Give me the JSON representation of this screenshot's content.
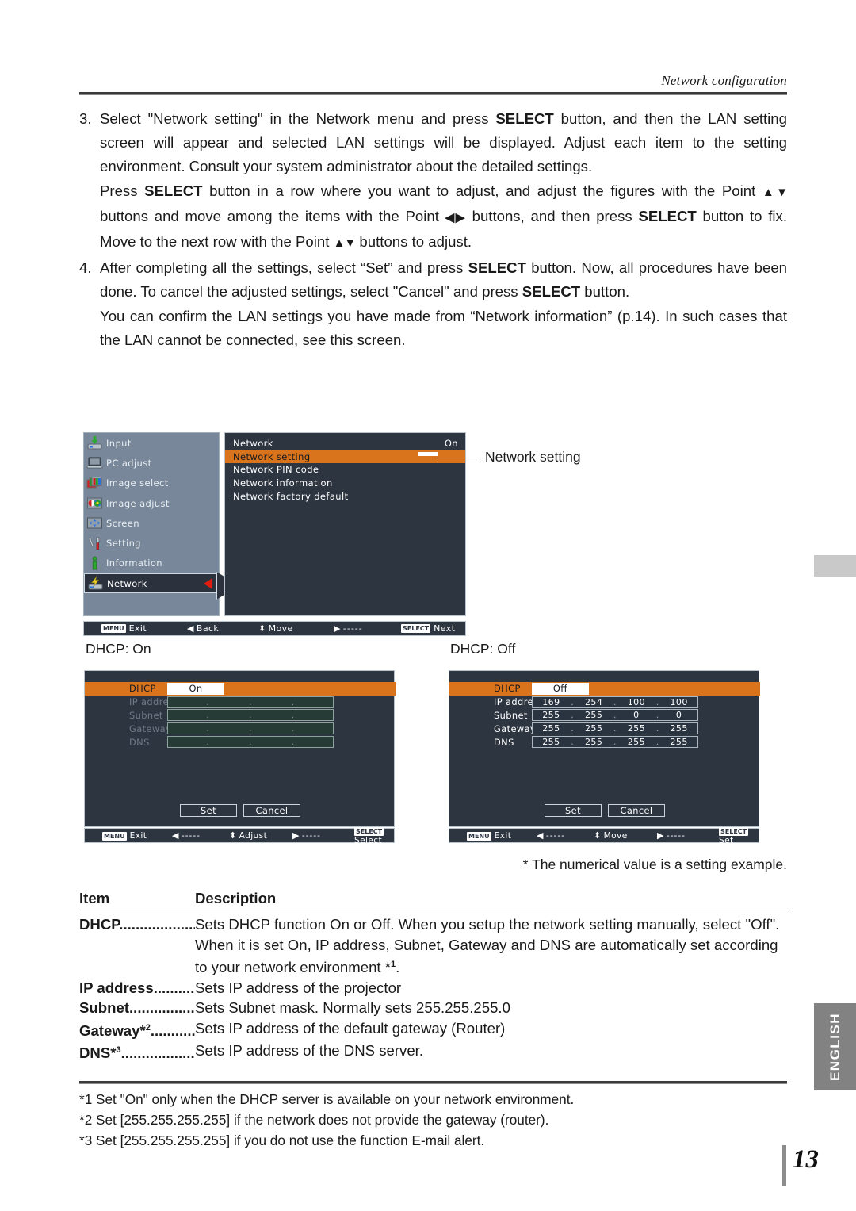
{
  "header": {
    "title": "Network configuration"
  },
  "steps": {
    "s3_num": "3.",
    "s3_a": "Select \"Network setting\" in the Network menu and press ",
    "s3_select": "SELECT",
    "s3_b": " button, and then the LAN setting screen will appear and selected LAN settings will be displayed. Adjust each item to the setting environment. Consult your system administrator about the detailed settings.",
    "s3_press_a": "Press ",
    "s3_press_b": " button in a row where you want to adjust, and adjust the figures with the Point ",
    "s3_press_c": " buttons and move among the items with the Point ",
    "s3_press_d": " buttons, and then press ",
    "s3_press_e": " button to fix. Move to the next row with the Point ",
    "s3_press_f": " buttons to adjust.",
    "updown": "▲▼",
    "leftright": "◀▶",
    "s4_num": "4.",
    "s4_a": "After completing all the settings, select “Set” and press ",
    "s4_b": " button. Now, all procedures have been done. To cancel the adjusted settings, select \"Cancel\" and press ",
    "s4_c": " button.",
    "s4_confirm": "You can confirm the LAN settings you have made from “Network information” (p.14). In such cases  that the LAN cannot be connected, see this screen."
  },
  "osd_menu": {
    "sidebar": [
      {
        "label": "Input",
        "icon": "input-tray-icon",
        "selected": false
      },
      {
        "label": "PC adjust",
        "icon": "laptop-icon",
        "selected": false
      },
      {
        "label": "Image select",
        "icon": "rgb-layers-icon",
        "selected": false
      },
      {
        "label": "Image adjust",
        "icon": "contrast-palette-icon",
        "selected": false
      },
      {
        "label": "Screen",
        "icon": "screen-resize-icon",
        "selected": false
      },
      {
        "label": "Setting",
        "icon": "wrench-screwdriver-icon",
        "selected": false
      },
      {
        "label": "Information",
        "icon": "info-icon",
        "selected": false
      },
      {
        "label": "Network",
        "icon": "lightning-network-icon",
        "selected": true
      }
    ],
    "panel": [
      {
        "label": "Network",
        "value": "On",
        "highlighted": false
      },
      {
        "label": "Network setting",
        "value": "",
        "highlighted": true
      },
      {
        "label": "Network PIN code",
        "value": "",
        "highlighted": false
      },
      {
        "label": "Network information",
        "value": "",
        "highlighted": false
      },
      {
        "label": "Network factory default",
        "value": "",
        "highlighted": false
      }
    ],
    "statusbar": [
      {
        "key": "MENU",
        "glyph": "",
        "label": "Exit"
      },
      {
        "key": "",
        "glyph": "◀",
        "label": "Back"
      },
      {
        "key": "",
        "glyph": "⬍",
        "label": "Move"
      },
      {
        "key": "",
        "glyph": "▶",
        "label": "-----"
      },
      {
        "key": "SELECT",
        "glyph": "",
        "label": "Next"
      }
    ],
    "callout": "Network setting"
  },
  "lan_on": {
    "caption": "DHCP: On",
    "dhcp_label": "DHCP",
    "dhcp_value": "On",
    "rows": [
      {
        "label": "IP address",
        "octets": [
          "",
          "",
          "",
          ""
        ]
      },
      {
        "label": "Subnet",
        "octets": [
          "",
          "",
          "",
          ""
        ]
      },
      {
        "label": "Gateway",
        "octets": [
          "",
          "",
          "",
          ""
        ]
      },
      {
        "label": "DNS",
        "octets": [
          "",
          "",
          "",
          ""
        ]
      }
    ],
    "set_label": "Set",
    "cancel_label": "Cancel",
    "statusbar": [
      {
        "key": "MENU",
        "glyph": "",
        "label": "Exit"
      },
      {
        "key": "",
        "glyph": "◀",
        "label": "-----"
      },
      {
        "key": "",
        "glyph": "⬍",
        "label": "Adjust"
      },
      {
        "key": "",
        "glyph": "▶",
        "label": "-----"
      },
      {
        "key": "SELECT",
        "glyph": "",
        "label": "Select"
      }
    ]
  },
  "lan_off": {
    "caption": "DHCP: Off",
    "dhcp_label": "DHCP",
    "dhcp_value": "Off",
    "rows": [
      {
        "label": "IP address",
        "octets": [
          "169",
          "254",
          "100",
          "100"
        ]
      },
      {
        "label": "Subnet",
        "octets": [
          "255",
          "255",
          "0",
          "0"
        ]
      },
      {
        "label": "Gateway",
        "octets": [
          "255",
          "255",
          "255",
          "255"
        ]
      },
      {
        "label": "DNS",
        "octets": [
          "255",
          "255",
          "255",
          "255"
        ]
      }
    ],
    "set_label": "Set",
    "cancel_label": "Cancel",
    "statusbar": [
      {
        "key": "MENU",
        "glyph": "",
        "label": "Exit"
      },
      {
        "key": "",
        "glyph": "◀",
        "label": "-----"
      },
      {
        "key": "",
        "glyph": "⬍",
        "label": "Move"
      },
      {
        "key": "",
        "glyph": "▶",
        "label": "-----"
      },
      {
        "key": "SELECT",
        "glyph": "",
        "label": "Set"
      }
    ]
  },
  "note_example": "* The numerical value is a setting example.",
  "table": {
    "head_item": "Item",
    "head_desc": "Description",
    "rows": [
      {
        "item": "DHCP",
        "dots": "...................",
        "sup": "",
        "desc": "Sets DHCP function On or Off. When you setup the network setting manually, select \"Off\". When it is set On, IP address, Subnet, Gateway  and DNS are automatically set according to your network environment *",
        "desc_sup": "1",
        "desc_tail": "."
      },
      {
        "item": "IP address",
        "dots": ".............",
        "sup": "",
        "desc": "Sets IP address of the projector",
        "desc_sup": "",
        "desc_tail": ""
      },
      {
        "item": "Subnet",
        "dots": "....................",
        "sup": "",
        "desc": "Sets Subnet mask. Normally sets 255.255.255.0",
        "desc_sup": "",
        "desc_tail": ""
      },
      {
        "item": "Gateway*",
        "dots": "............",
        "sup": "2",
        "desc": "Sets IP address of the default gateway (Router)",
        "desc_sup": "",
        "desc_tail": ""
      },
      {
        "item": "DNS*",
        "dots": ".......................",
        "sup": "3",
        "desc": "Sets IP address of the DNS server.",
        "desc_sup": "",
        "desc_tail": ""
      }
    ]
  },
  "footnotes": [
    "*1 Set \"On\" only when the DHCP server is available on your network environment.",
    "*2 Set [255.255.255.255] if the network does not provide the gateway (router).",
    "*3 Set [255.255.255.255] if you do not use the function E-mail alert."
  ],
  "side_tab": {
    "language": "ENGLISH"
  },
  "page_number": "13",
  "colors": {
    "osd_panel_bg": "#2d3541",
    "osd_sidebar_bg": "#78889a",
    "osd_highlight": "#d9741d",
    "arrow_red": "#e01b10",
    "tab_gray": "#828282"
  }
}
